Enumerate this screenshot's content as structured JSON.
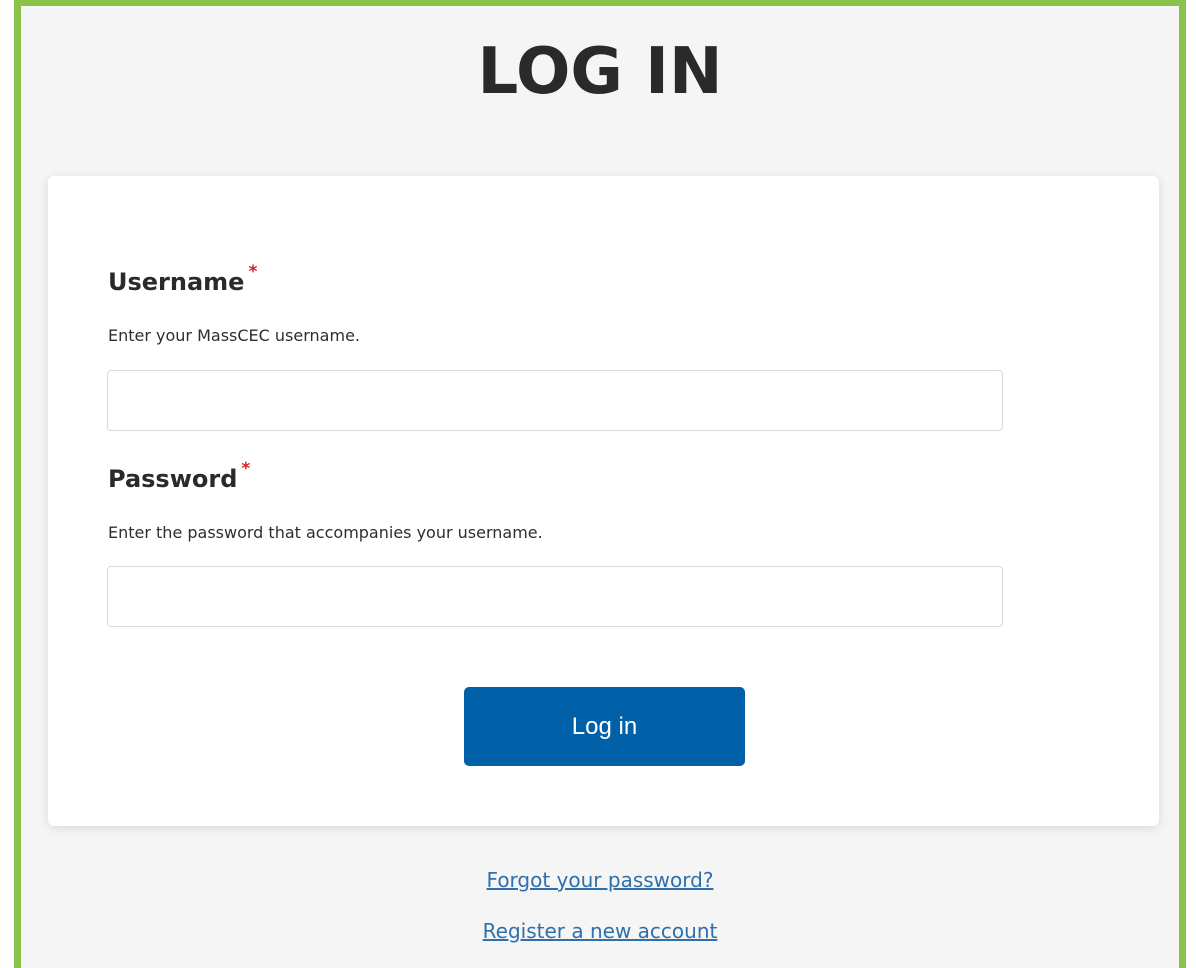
{
  "page": {
    "title": "LOG IN"
  },
  "form": {
    "username": {
      "label": "Username",
      "required_marker": "*",
      "help": "Enter your MassCEC username.",
      "value": ""
    },
    "password": {
      "label": "Password",
      "required_marker": "*",
      "help": "Enter the password that accompanies your username.",
      "value": ""
    },
    "submit_label": "Log in"
  },
  "links": {
    "forgot_password": "Forgot your password?",
    "register": "Register a new account"
  },
  "colors": {
    "frame_border": "#8bc34a",
    "button_bg": "#0061a8",
    "link": "#2f6fac",
    "required": "#e02020"
  }
}
